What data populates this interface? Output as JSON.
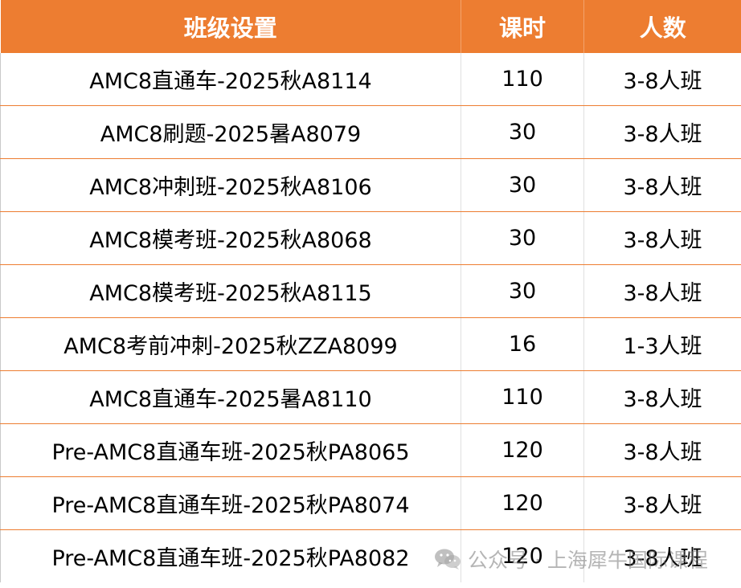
{
  "table": {
    "headers": [
      "班级设置",
      "课时",
      "人数"
    ],
    "rows": [
      [
        "AMC8直通车-2025秋A8114",
        "110",
        "3-8人班"
      ],
      [
        "AMC8刷题-2025暑A8079",
        "30",
        "3-8人班"
      ],
      [
        "AMC8冲刺班-2025秋A8106",
        "30",
        "3-8人班"
      ],
      [
        "AMC8模考班-2025秋A8068",
        "30",
        "3-8人班"
      ],
      [
        "AMC8模考班-2025秋A8115",
        "30",
        "3-8人班"
      ],
      [
        "AMC8考前冲刺-2025秋ZZA8099",
        "16",
        "1-3人班"
      ],
      [
        "AMC8直通车-2025暑A8110",
        "110",
        "3-8人班"
      ],
      [
        "Pre-AMC8直通车班-2025秋PA8065",
        "120",
        "3-8人班"
      ],
      [
        "Pre-AMC8直通车班-2025秋PA8074",
        "120",
        "3-8人班"
      ],
      [
        "Pre-AMC8直通车班-2025秋PA8082",
        "120",
        "3-8人班"
      ]
    ]
  },
  "watermark": {
    "icon": "wechat-icon",
    "text": "公众号 · 上海犀牛国际课程"
  },
  "colors": {
    "header_bg": "#ed7d31",
    "header_text": "#ffffff",
    "row_divider": "#ed7d31"
  }
}
